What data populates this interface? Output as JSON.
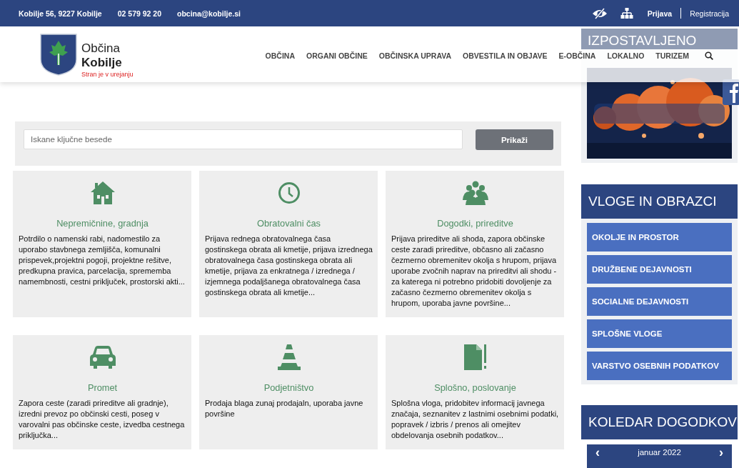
{
  "top_bar": {
    "address": "Kobilje 56, 9227 Kobilje",
    "phone": "02 579 92 20",
    "email": "obcina@kobilje.si",
    "login": "Prijava",
    "register": "Registracija"
  },
  "header": {
    "logo_line_1": "Občina",
    "logo_line_2": "Kobilje",
    "tagline": "Stran je v urejanju",
    "nav": [
      "OBČINA",
      "ORGANI OBČINE",
      "OBČINSKA UPRAVA",
      "OBVESTILA IN OBJAVE",
      "E-OBČINA",
      "LOKALNO",
      "TURIZEM"
    ]
  },
  "search": {
    "placeholder": "Iskane ključne besede",
    "button": "Prikaži"
  },
  "cards": [
    {
      "title": "Nepremičnine, gradnja",
      "text": "Potrdilo o namenski rabi, nadomestilo za uporabo stavbnega zemljišča, komunalni prispevek,projektni pogoji, projektne rešitve, predkupna pravica, parcelacija, sprememba namembnosti, cestni priključek, prostorski akti..."
    },
    {
      "title": "Obratovalni čas",
      "text": "Prijava rednega obratovalnega časa gostinskega obrata ali kmetije, prijava izrednega obratovalnega časa gostinskega obrata ali kmetije, prijava za enkratnega / izrednega / izjemnega podaljšanega obratovalnega časa gostinskega obrata ali kmetije..."
    },
    {
      "title": "Dogodki, prireditve",
      "text": "Prijava prireditve ali shoda, zapora občinske ceste zaradi prireditve, občasno ali začasno čezmerno obremenitev okolja s hrupom, prijava uporabe zvočnih naprav na prireditvi ali shodu - za katerega ni potrebno pridobiti dovoljenje za začasno čezmerno obremenitev okolja s hrupom, uporaba javne površine..."
    },
    {
      "title": "Promet",
      "text": "Zapora ceste (zaradi prireditve ali gradnje), izredni prevoz po občinski cesti, poseg v varovalni pas občinske ceste, izvedba cestnega priključka..."
    },
    {
      "title": "Podjetništvo",
      "text": "Prodaja blaga zunaj prodajaln, uporaba javne površine"
    },
    {
      "title": "Splošno, poslovanje",
      "text": "Splošna vloga, pridobitev informacij javnega značaja, seznanitev z lastnimi osebnimi podatki, popravek / izbris / prenos ali omejitev obdelovanja osebnih podatkov..."
    }
  ],
  "sidebar": {
    "featured": {
      "title": "IZPOSTAVLJENO"
    },
    "forms": {
      "title": "VLOGE IN OBRAZCI",
      "items": [
        "OKOLJE IN PROSTOR",
        "DRUŽBENE DEJAVNOSTI",
        "SOCIALNE DEJAVNOSTI",
        "SPLOŠNE VLOGE",
        "VARSTVO OSEBNIH PODATKOV"
      ]
    },
    "calendar": {
      "title": "KOLEDAR DOGODKOV",
      "month": "januar 2022",
      "prev": "‹",
      "next": "›"
    }
  }
}
